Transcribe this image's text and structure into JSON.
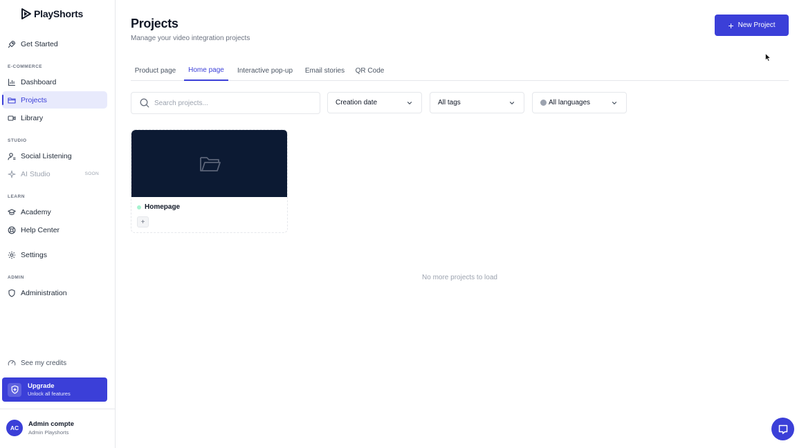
{
  "brand": {
    "name": "PlayShorts"
  },
  "sidebar": {
    "get_started": "Get Started",
    "sections": {
      "ecommerce": "E-COMMERCE",
      "studio": "STUDIO",
      "learn": "LEARN",
      "admin": "ADMIN"
    },
    "items": {
      "dashboard": "Dashboard",
      "projects": "Projects",
      "library": "Library",
      "social_listening": "Social Listening",
      "ai_studio": "AI Studio",
      "ai_studio_badge": "SOON",
      "academy": "Academy",
      "help_center": "Help Center",
      "settings": "Settings",
      "administration": "Administration"
    },
    "credits": "See my credits",
    "upgrade": {
      "title": "Upgrade",
      "subtitle": "Unlock all features"
    },
    "user": {
      "initials": "AC",
      "name": "Admin compte",
      "org": "Admin Playshorts"
    }
  },
  "header": {
    "title": "Projects",
    "subtitle": "Manage your video integration projects",
    "new_button": "New Project"
  },
  "tabs": [
    {
      "label": "Product page",
      "active": false
    },
    {
      "label": "Home page",
      "active": true
    },
    {
      "label": "Interactive pop-up",
      "active": false
    },
    {
      "label": "Email stories",
      "active": false
    },
    {
      "label": "QR Code",
      "active": false
    }
  ],
  "filters": {
    "search_placeholder": "Search projects...",
    "search_value": "",
    "sort": "Creation date",
    "tags": "All tags",
    "languages": "All languages"
  },
  "projects": [
    {
      "name": "Homepage",
      "status_color": "#a7f3d0",
      "add_tag": "+"
    }
  ],
  "empty_message": "No more projects to load",
  "colors": {
    "accent": "#3b3fd8",
    "thumb_bg": "#0c1a33",
    "active_bg": "#e8eafc"
  }
}
